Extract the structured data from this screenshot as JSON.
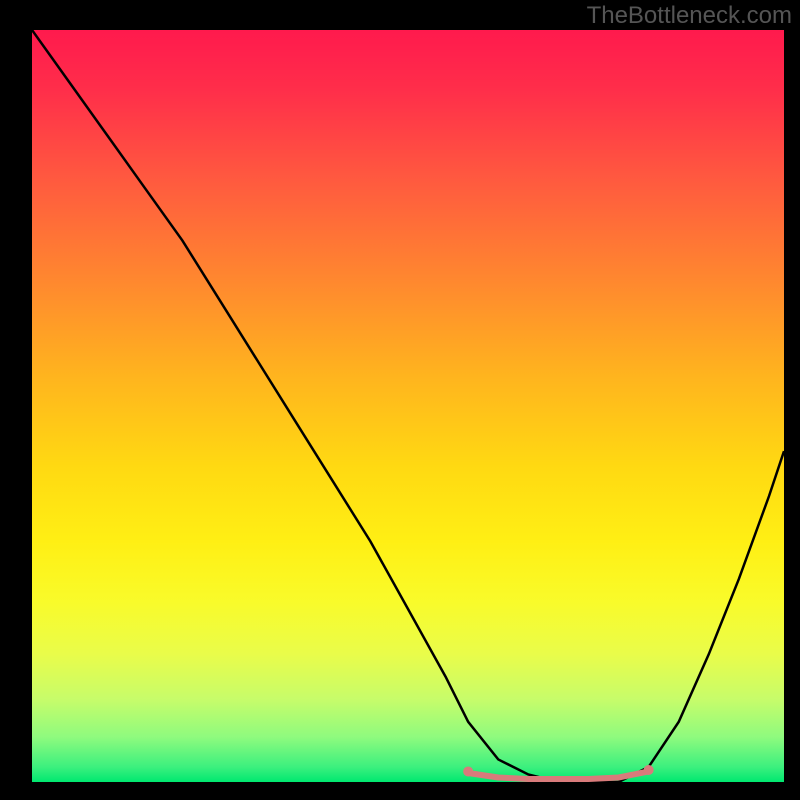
{
  "watermark": "TheBottleneck.com",
  "chart_data": {
    "type": "line",
    "title": "",
    "xlabel": "",
    "ylabel": "",
    "xlim": [
      0,
      100
    ],
    "ylim": [
      0,
      100
    ],
    "grid": false,
    "legend": false,
    "background_gradient": {
      "top": "#ff1a4d",
      "middle": "#ffd912",
      "bottom": "#00e870"
    },
    "series": [
      {
        "name": "bottleneck-curve",
        "color": "#000000",
        "x": [
          0,
          5,
          10,
          15,
          20,
          25,
          30,
          35,
          40,
          45,
          50,
          55,
          58,
          62,
          66,
          70,
          74,
          78,
          82,
          86,
          90,
          94,
          98,
          100
        ],
        "y": [
          100,
          93,
          86,
          79,
          72,
          64,
          56,
          48,
          40,
          32,
          23,
          14,
          8,
          3,
          1,
          0,
          0,
          0,
          2,
          8,
          17,
          27,
          38,
          44
        ]
      },
      {
        "name": "baseline-highlight",
        "color": "#d97b7b",
        "stroke_width": 6,
        "x": [
          58,
          62,
          66,
          70,
          74,
          78,
          82
        ],
        "y": [
          1.2,
          0.6,
          0.4,
          0.4,
          0.4,
          0.6,
          1.4
        ]
      }
    ],
    "markers": [
      {
        "x": 58,
        "y": 1.4,
        "color": "#d97b7b",
        "r": 5
      },
      {
        "x": 82,
        "y": 1.6,
        "color": "#d97b7b",
        "r": 5
      }
    ]
  }
}
